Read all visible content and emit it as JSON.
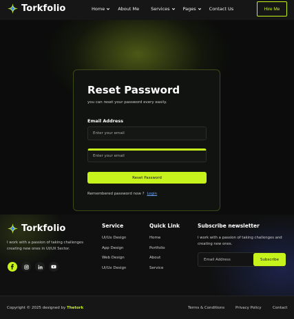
{
  "brand": {
    "name": "Torkfolio",
    "icon": "sparkle-star-icon"
  },
  "header": {
    "nav": [
      {
        "label": "Home",
        "has_dropdown": true
      },
      {
        "label": "About Me",
        "has_dropdown": false
      },
      {
        "label": "Services",
        "has_dropdown": true
      },
      {
        "label": "Pages",
        "has_dropdown": true
      },
      {
        "label": "Contact Us",
        "has_dropdown": false
      }
    ],
    "hire_label": "Hire Me"
  },
  "reset_card": {
    "title": "Reset Password",
    "subtitle": "you can reset your password every easily.",
    "email_label": "Email Address",
    "email_placeholder": "Enter your email",
    "confirm_placeholder": "Enter your email",
    "button_label": "Reset Password",
    "remember_text": "Remembered password now ?",
    "login_link": "Login"
  },
  "footer": {
    "about_text": "I work with a passion of taking challenges creating new ones in UI/UX Sector.",
    "socials": [
      "facebook-icon",
      "instagram-icon",
      "linkedin-icon",
      "youtube-icon"
    ],
    "service": {
      "title": "Service",
      "items": [
        "Ui/Ux Design",
        "App Design",
        "Web Design",
        "Ui/Ux Design"
      ]
    },
    "quick_link": {
      "title": "Quick Link",
      "items": [
        "Home",
        "Portfolio",
        "About",
        "Service"
      ]
    },
    "newsletter": {
      "title": "Subscribe newsletter",
      "text": "I work with a passion of taking challenges and creating new ones.",
      "placeholder": "Email Address",
      "button_label": "Subscribe"
    }
  },
  "bottom_bar": {
    "copyright_prefix": "Copyright © 2025 designed by",
    "copyright_brand": "Thetork",
    "links": [
      "Terms & Conditions",
      "Privacy Policy",
      "Contact"
    ]
  },
  "colors": {
    "accent": "#c7f31d",
    "link": "#6aa8ff",
    "background": "#0b0c0b"
  }
}
